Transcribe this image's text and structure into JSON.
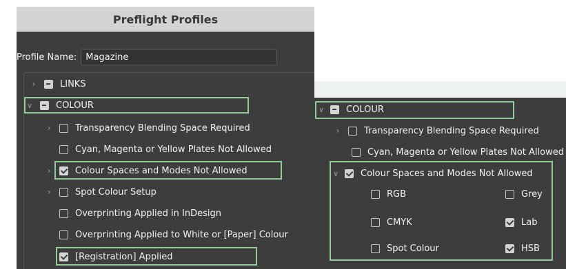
{
  "left_panel": {
    "title": "Preflight Profiles",
    "profile_label": "Profile Name:",
    "profile_value": "Magazine",
    "tree": {
      "links": "LINKS",
      "colour": "COLOUR",
      "items": [
        {
          "label": "Transparency Blending Space Required",
          "checked": false
        },
        {
          "label": "Cyan, Magenta or Yellow Plates Not Allowed",
          "checked": false
        },
        {
          "label": "Colour Spaces and Modes Not Allowed",
          "checked": true
        },
        {
          "label": "Spot Colour Setup",
          "checked": false
        },
        {
          "label": "Overprinting Applied in InDesign",
          "checked": false
        },
        {
          "label": "Overprinting Applied to White or [Paper] Colour",
          "checked": false
        },
        {
          "label": "[Registration] Applied",
          "checked": true
        }
      ]
    }
  },
  "right_panel": {
    "colour": "COLOUR",
    "items": [
      {
        "label": "Transparency Blending Space Required",
        "checked": false
      },
      {
        "label": "Cyan, Magenta or Yellow Plates Not Allowed",
        "checked": false
      },
      {
        "label": "Colour Spaces and Modes Not Allowed",
        "checked": true
      }
    ],
    "modes": {
      "rgb": {
        "label": "RGB",
        "checked": false
      },
      "grey": {
        "label": "Grey",
        "checked": false
      },
      "cmyk": {
        "label": "CMYK",
        "checked": false
      },
      "lab": {
        "label": "Lab",
        "checked": true
      },
      "spot": {
        "label": "Spot Colour",
        "checked": false
      },
      "hsb": {
        "label": "HSB",
        "checked": true
      }
    }
  },
  "colors": {
    "panel_bg": "#3d3d3d",
    "title_bar_bg": "#d3d3d3",
    "highlight": "#8fcf97"
  },
  "icons": {
    "collapsed": "chevron-right-icon",
    "expanded": "chevron-down-icon",
    "checkbox": "checkbox-icon"
  }
}
